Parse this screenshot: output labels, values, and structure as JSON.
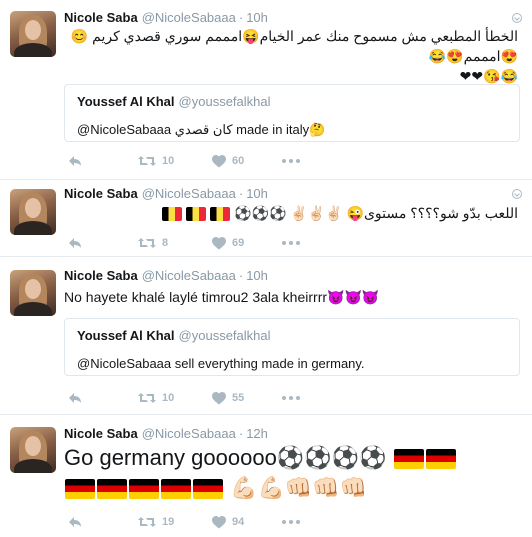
{
  "tweets": [
    {
      "name": "Nicole Saba",
      "handle": "@NicoleSabaaa",
      "dot": "·",
      "time": "10h",
      "text": "الخطأ المطبعي مش مسموح منك عمر الخيام😝امممم سوري قصدي كريم 😊😍امممم😍😂\n😂😘❤❤",
      "quote": {
        "name": "Youssef Al Khal",
        "handle": "@youssefalkhal",
        "text": "@NicoleSabaaa كان قصدي made in italy🤔"
      },
      "replies": "",
      "retweets": "10",
      "likes": "60"
    },
    {
      "name": "Nicole Saba",
      "handle": "@NicoleSabaaa",
      "dot": "·",
      "time": "10h",
      "text": "اللعب بدّو شو؟؟؟؟ مستوى😜 ✌🏻✌🏻✌🏻 ⚽⚽⚽",
      "replies": "",
      "retweets": "8",
      "likes": "69"
    },
    {
      "name": "Nicole Saba",
      "handle": "@NicoleSabaaa",
      "dot": "·",
      "time": "10h",
      "text": "No hayete khalé laylé timrou2 3ala kheirrrr😈😈😈",
      "quote": {
        "name": "Youssef Al Khal",
        "handle": "@youssefalkhal",
        "text": "@NicoleSabaaa sell everything made in germany."
      },
      "replies": "",
      "retweets": "10",
      "likes": "55"
    },
    {
      "name": "Nicole Saba",
      "handle": "@NicoleSabaaa",
      "dot": "·",
      "time": "12h",
      "text": "Go germany goooooo⚽⚽⚽⚽",
      "text2": "💪🏻💪🏻👊🏻👊🏻👊🏻",
      "replies": "",
      "retweets": "19",
      "likes": "94"
    }
  ],
  "colors": {
    "icon": "#aab8c2",
    "secondary": "#8899a6",
    "border": "#e6ecf0",
    "avatar_accent": "#8a6046"
  },
  "icons": [
    "reply-icon",
    "retweet-icon",
    "like-icon",
    "more-icon",
    "caret-icon"
  ]
}
